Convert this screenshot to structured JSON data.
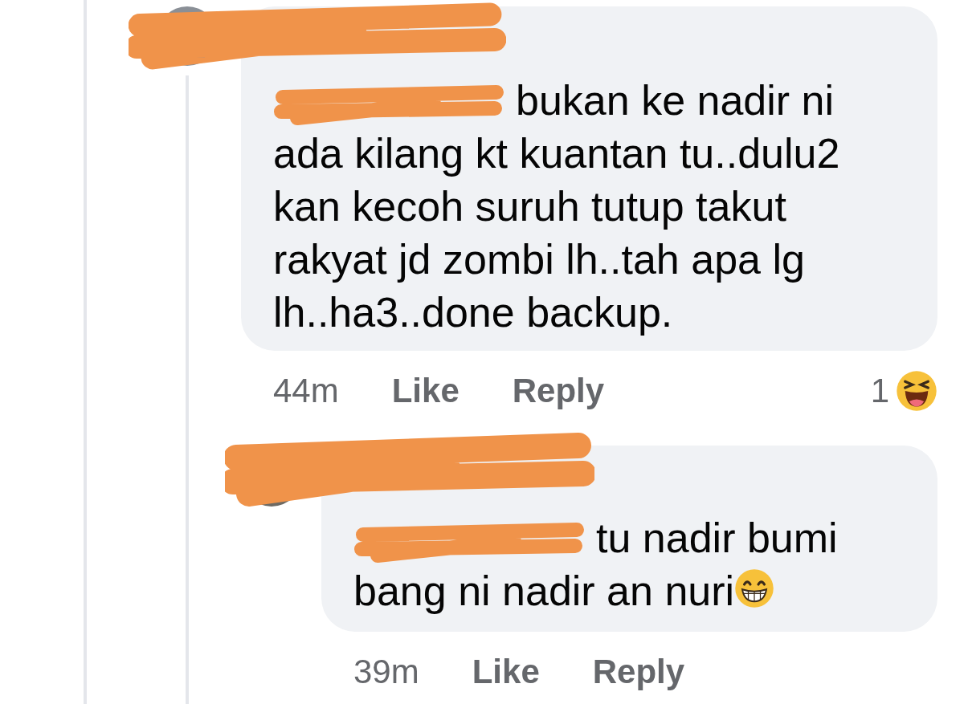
{
  "comments": [
    {
      "text": "bukan ke nadir ni ada kilang kt kuantan tu..dulu2 kan kecoh suruh tutup takut rakyat jd zombi lh..tah apa lg lh..ha3..done backup.",
      "time": "44m",
      "actions": [
        "Like",
        "Reply"
      ],
      "reaction": {
        "count": "1",
        "kind": "laugh"
      },
      "children": [
        {
          "text": "tu nadir bumi bang ni nadir an nuri",
          "end_emoji": {
            "kind": "grin"
          },
          "time": "39m",
          "actions": [
            "Like",
            "Reply"
          ]
        }
      ]
    }
  ]
}
